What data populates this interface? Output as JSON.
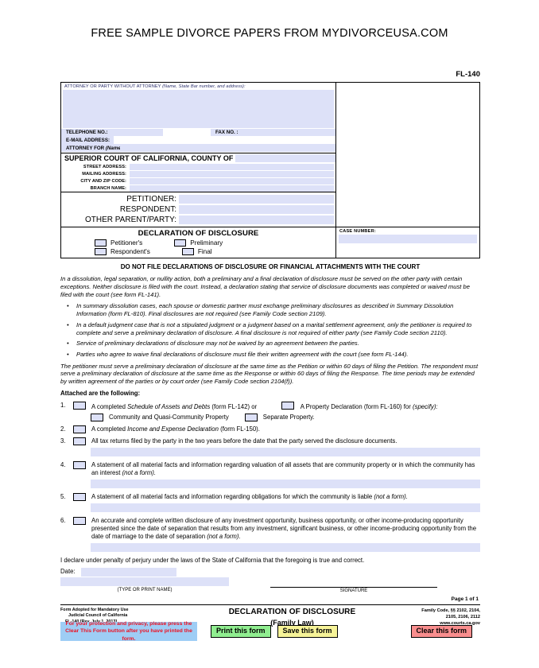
{
  "banner": {
    "text": "FREE SAMPLE DIVORCE PAPERS FROM MYDIVORCEUSA.COM"
  },
  "form_number": "FL-140",
  "caption": {
    "attorney_label": "ATTORNEY OR PARTY WITHOUT ATTORNEY ",
    "attorney_label_italic": "(Name, State Bar number, and address):",
    "telephone_label": "TELEPHONE NO.:",
    "fax_label": "FAX NO. :",
    "email_label": "E-MAIL ADDRESS:",
    "attorney_for_label": "ATTORNEY FOR ",
    "attorney_for_italic": "(Name):",
    "court_header": "SUPERIOR COURT OF CALIFORNIA, COUNTY OF",
    "address_rows": [
      "STREET ADDRESS:",
      "MAILING ADDRESS:",
      "CITY AND ZIP CODE:",
      "BRANCH NAME:"
    ],
    "parties": [
      "PETITIONER:",
      "RESPONDENT:",
      "OTHER PARENT/PARTY:"
    ],
    "case_number_label": "CASE NUMBER:"
  },
  "title_block": {
    "title": "DECLARATION OF DISCLOSURE",
    "checkboxes": [
      {
        "left": "Petitioner's",
        "right": "Preliminary"
      },
      {
        "left": "Respondent's",
        "right": "Final"
      }
    ]
  },
  "body": {
    "warning": "DO NOT FILE DECLARATIONS OF DISCLOSURE OR FINANCIAL ATTACHMENTS WITH THE COURT",
    "intro": "In a dissolution, legal separation, or nullity action, both a preliminary and a final declaration of disclosure must be served on the other party with certain exceptions. Neither disclosure is filed with the court. Instead, a declaration stating that service of disclosure documents was completed or waived must be filed with the court (see form FL-141).",
    "bullets": [
      "In summary dissolution cases, each spouse or domestic partner must exchange preliminary disclosures as described in Summary Dissolution Information (form FL-810). Final disclosures are not required (see Family Code section 2109).",
      "In a default judgment case that is not a stipulated judgment or a judgment based on a marital settlement agreement, only the petitioner is required to complete and serve a preliminary declaration of disclosure. A final disclosure is not required of either party (see Family Code section 2110).",
      "Service of preliminary declarations of disclosure may not be waived by an agreement between the parties.",
      "Parties who agree to waive final declarations of disclosure must file their written agreement with the court (see form FL-144)."
    ],
    "timing": "The petitioner must serve a preliminary declaration of disclosure at the same time as the Petition or within 60 days of filing the Petition. The respondent must serve a preliminary declaration of disclosure at the same time as the Response or within 60 days of filing the Response. The time periods may be extended by written agreement of the parties or by court order (see Family Code section 2104(f)).",
    "attached_heading": "Attached are the following:",
    "items": [
      {
        "num": "1.",
        "text_a": "A completed ",
        "text_a_ital": "Schedule of Assets and Debts",
        "text_a_end": " (form FL-142) or",
        "text_b": "A Property Declaration (form FL-160) for ",
        "text_b_ital": "(specify):",
        "sub_a": "Community and Quasi-Community Property",
        "sub_b": "Separate Property."
      },
      {
        "num": "2.",
        "text": "A completed ",
        "text_ital": "Income and Expense Declaration",
        "text_end": " (form FL-150)."
      },
      {
        "num": "3.",
        "text": "All tax returns filed by the party in the two years before the date that the party served the disclosure documents."
      },
      {
        "num": "4.",
        "text": "A statement of all material facts and information regarding valuation of all assets that are community property or in which the community has an interest ",
        "text_ital": "(not a form)."
      },
      {
        "num": "5.",
        "text": "A statement of all material facts and information regarding obligations for which the community is liable ",
        "text_ital": "(not a form)."
      },
      {
        "num": "6.",
        "text": "An accurate and complete written disclosure of any investment opportunity, business opportunity, or other income-producing opportunity presented since the date of separation that results from any investment, significant business, or other income-producing opportunity from the date of marriage to the date of separation ",
        "text_ital": "(not a form)."
      }
    ],
    "perjury": "I declare under penalty of perjury under the laws of the State of California that the foregoing is true and correct.",
    "date_label": "Date:",
    "type_or_print_name": "(TYPE OR PRINT NAME)",
    "signature_label": "SIGNATURE",
    "page_of": "Page 1 of 1"
  },
  "footer": {
    "left": [
      "Form Adopted for Mandatory Use",
      "Judicial Council of California",
      "FL-140 [Rev. July 1, 2013]"
    ],
    "center_line1": "DECLARATION OF DISCLOSURE",
    "center_line2": "(Family Law)",
    "right": [
      "Family Code, §§ 2102, 2104,",
      "2105, 2106, 2112",
      "www.courts.ca.gov"
    ]
  },
  "action_bar": {
    "notice": "For your protection and privacy, please press the Clear This Form button after you have printed the form.",
    "print_label": "Print this form",
    "save_label": "Save this form",
    "clear_label": "Clear this form"
  },
  "colors": {
    "field_fill": "#dde1f8",
    "notice_bg": "#9ecdf5",
    "notice_text": "#ee1122",
    "print_bg": "#90ee90",
    "save_bg": "#f6f398",
    "clear_bg": "#f98e8e"
  }
}
